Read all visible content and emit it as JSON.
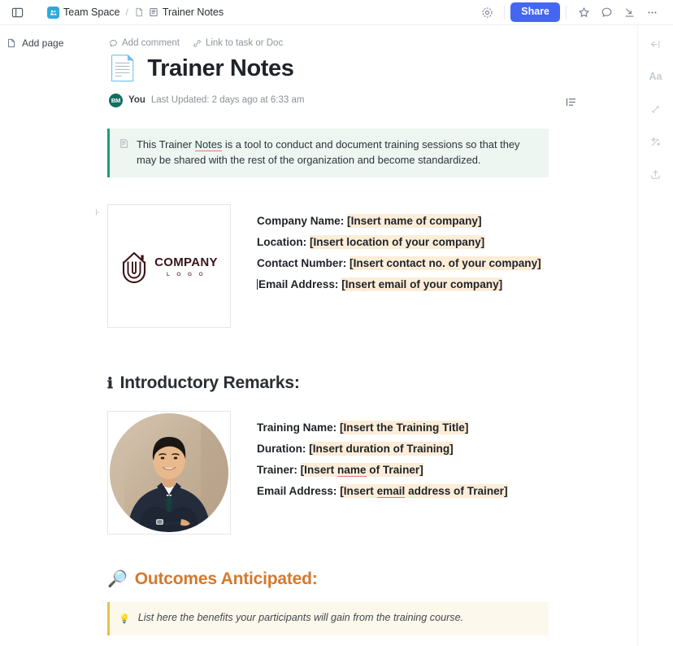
{
  "topbar": {
    "panel_toggle_icon": "panel-toggle-icon",
    "breadcrumb": {
      "space_label": "Team Space",
      "space_icon": "team-space-icon",
      "separator": "/",
      "doc_icon": "doc-small-icon",
      "page_icon": "notes-page-icon",
      "page_label": "Trainer Notes"
    },
    "actions": {
      "history_icon": "clock-history-icon",
      "share_label": "Share",
      "star_icon": "star-icon",
      "comment_icon": "comment-bubble-icon",
      "collapse_icon": "collapse-down-icon",
      "more_icon": "more-horizontal-icon"
    }
  },
  "sidebar": {
    "add_page_label": "Add page",
    "add_page_icon": "add-page-icon"
  },
  "doc": {
    "actions": {
      "add_comment_label": "Add comment",
      "add_comment_icon": "comment-bubble-icon",
      "link_task_label": "Link to task or Doc",
      "link_task_icon": "link-sparkle-icon"
    },
    "title_emoji": "page-with-curl-emoji",
    "title": "Trainer Notes",
    "meta": {
      "avatar_initials": "BM",
      "author": "You",
      "updated": "Last Updated: 2 days ago at 6:33 am"
    },
    "outline_icon": "outline-list-icon",
    "block_plus_icon": "plus-icon",
    "intro_callout": {
      "icon": "note-pin-icon",
      "text_part1": "This Trainer ",
      "misspelled": "Notes",
      "text_part2": " is a tool to conduct and document training sessions so that they may be shared with the rest of the organization and become standardized."
    },
    "company_block": {
      "logo": {
        "name": "COMPANY",
        "sub": "L O G O",
        "mark_icon": "company-house-shield-logo"
      },
      "fields": [
        {
          "label": "Company Name:",
          "value": "[Insert name of company]"
        },
        {
          "label": "Location:",
          "value": "[Insert location of your company]"
        },
        {
          "label": "Contact Number:",
          "value": "[Insert contact no. of your company]"
        },
        {
          "label": "Email Address:",
          "value": "[Insert email of your company]"
        }
      ]
    },
    "intro_section": {
      "emoji": "information-emoji",
      "heading": "Introductory Remarks:"
    },
    "trainer_block": {
      "photo_icon": "trainer-portrait-photo",
      "fields": [
        {
          "label": "Training Name:",
          "value": "[Insert the Training Title]"
        },
        {
          "label": "Duration:",
          "value": "[Insert duration of Training]"
        },
        {
          "label": "Trainer:",
          "value_a": "[Insert ",
          "misspelled": "name",
          "value_b": " of Trainer]"
        },
        {
          "label": "Email Address:",
          "value_a": "[Insert ",
          "misspelled": "email",
          "value_b": " address of Trainer]"
        }
      ]
    },
    "outcomes_section": {
      "emoji": "magnifying-glass-emoji",
      "heading": "Outcomes Anticipated:",
      "tip": {
        "icon": "light-bulb-emoji",
        "text": "List here the benefits your participants will gain from the training course."
      }
    }
  },
  "right_rail": {
    "items": [
      {
        "icon": "collapse-panel-icon",
        "label": "Collapse panel"
      },
      {
        "icon": "text-format-aa-icon",
        "label": "Aa"
      },
      {
        "icon": "ai-sparkle-icon",
        "label": "AI"
      },
      {
        "icon": "magic-wand-icon",
        "label": "Magic"
      },
      {
        "icon": "upload-share-icon",
        "label": "Export"
      }
    ]
  },
  "colors": {
    "accent": "#4466f2",
    "callout_green_bar": "#1f9d76",
    "callout_green_bg": "#edf6f1",
    "highlight": "#fcedd8",
    "orange_heading": "#d4792c",
    "tip_bar": "#e8c04a",
    "tip_bg": "#fdf8ec",
    "avatar": "#126e62",
    "logo_maroon": "#3a1418"
  }
}
